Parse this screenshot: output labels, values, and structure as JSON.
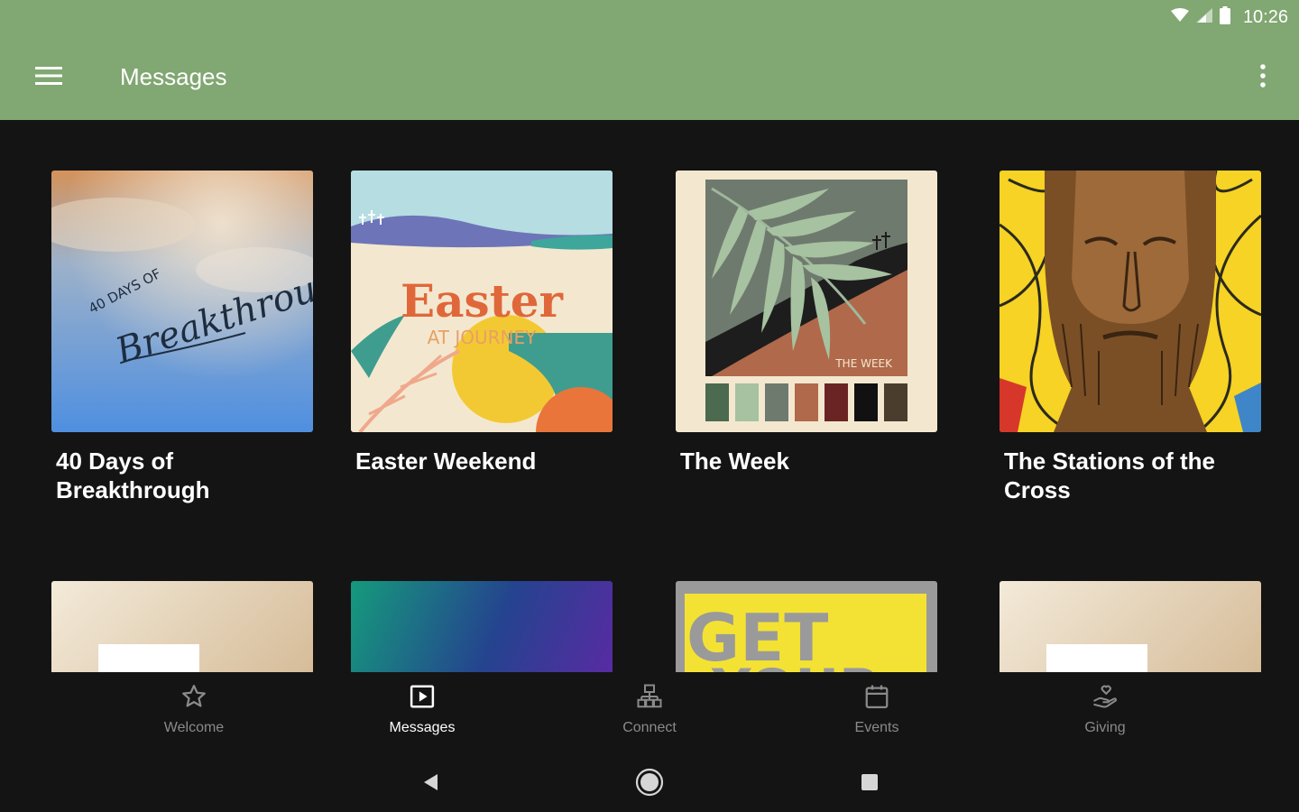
{
  "status_bar": {
    "time": "10:26",
    "icons": [
      "wifi-icon",
      "signal-icon",
      "battery-icon"
    ]
  },
  "app_bar": {
    "title": "Messages",
    "menu_icon": "hamburger-menu-icon",
    "more_icon": "more-vert-icon"
  },
  "cards": [
    {
      "title": "40 Days of Breakthrough",
      "art_text": [
        "40 DAYS OF",
        "Breakthrough"
      ]
    },
    {
      "title": "Easter Weekend",
      "art_text": [
        "Easter",
        "AT JOURNEY"
      ]
    },
    {
      "title": "The Week",
      "art_text": [
        "THE WEEK"
      ]
    },
    {
      "title": "The Stations of the Cross",
      "art_text": []
    },
    {
      "title": "",
      "art_text": []
    },
    {
      "title": "",
      "art_text": []
    },
    {
      "title": "",
      "art_text": [
        "GET",
        "YOUR"
      ]
    },
    {
      "title": "",
      "art_text": []
    }
  ],
  "bottom_nav": [
    {
      "label": "Welcome",
      "icon": "star-icon",
      "active": false
    },
    {
      "label": "Messages",
      "icon": "play-video-icon",
      "active": true
    },
    {
      "label": "Connect",
      "icon": "org-chart-icon",
      "active": false
    },
    {
      "label": "Events",
      "icon": "calendar-icon",
      "active": false
    },
    {
      "label": "Giving",
      "icon": "hand-heart-icon",
      "active": false
    }
  ],
  "system_nav": [
    "back-icon",
    "home-icon",
    "recents-icon"
  ],
  "colors": {
    "app_bar": "#81a772",
    "background": "#141414",
    "active_nav": "#ffffff",
    "inactive_nav": "#8a8a8a"
  }
}
